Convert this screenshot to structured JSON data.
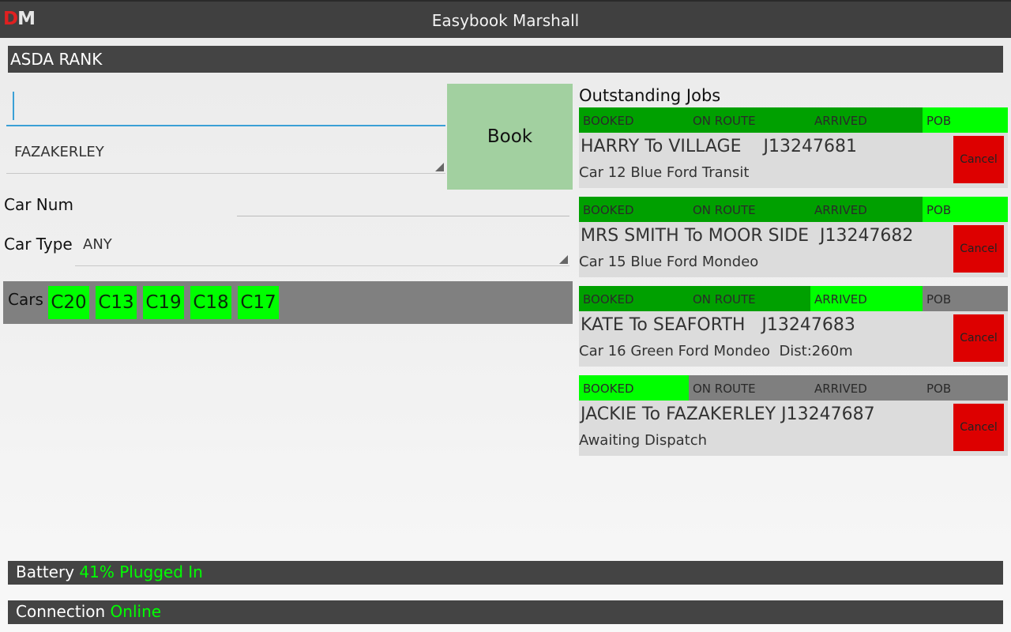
{
  "logo": {
    "d": "D",
    "m": "M"
  },
  "app": {
    "title": "Easybook Marshall"
  },
  "rank": {
    "name": "ASDA RANK"
  },
  "booking": {
    "destination_value": "",
    "pickup_selected": "FAZAKERLEY",
    "book_label": "Book",
    "car_num_label": "Car Num",
    "car_num_value": "",
    "car_type_label": "Car Type",
    "car_type_selected": "ANY"
  },
  "cars": {
    "label": "Cars",
    "items": [
      "C20",
      "C13",
      "C19",
      "C18",
      "C17"
    ]
  },
  "jobs": {
    "title": "Outstanding Jobs",
    "status_labels": [
      "BOOKED",
      "ON ROUTE",
      "ARRIVED",
      "POB"
    ],
    "cancel_label": "Cancel",
    "items": [
      {
        "title": "HARRY To VILLAGE    J13247681",
        "sub": "Car 12 Blue Ford Transit",
        "current_status": 3
      },
      {
        "title": "MRS SMITH To MOOR SIDE  J13247682",
        "sub": "Car 15 Blue Ford Mondeo",
        "current_status": 3
      },
      {
        "title": "KATE To SEAFORTH   J13247683",
        "sub": "Car 16 Green Ford Mondeo  Dist:260m",
        "current_status": 2
      },
      {
        "title": "JACKIE To FAZAKERLEY J13247687",
        "sub": "Awaiting Dispatch",
        "current_status": 0
      }
    ]
  },
  "footer": {
    "battery_label": "Battery",
    "battery_value": "41% Plugged In",
    "connection_label": "Connection",
    "connection_value": "Online"
  },
  "colors": {
    "status_done": "#00a000",
    "status_current": "#00ff00",
    "status_pending": "#7f7f7f",
    "cancel": "#dd0000",
    "book": "#a2d0a0",
    "car_chip": "#00ff00"
  }
}
